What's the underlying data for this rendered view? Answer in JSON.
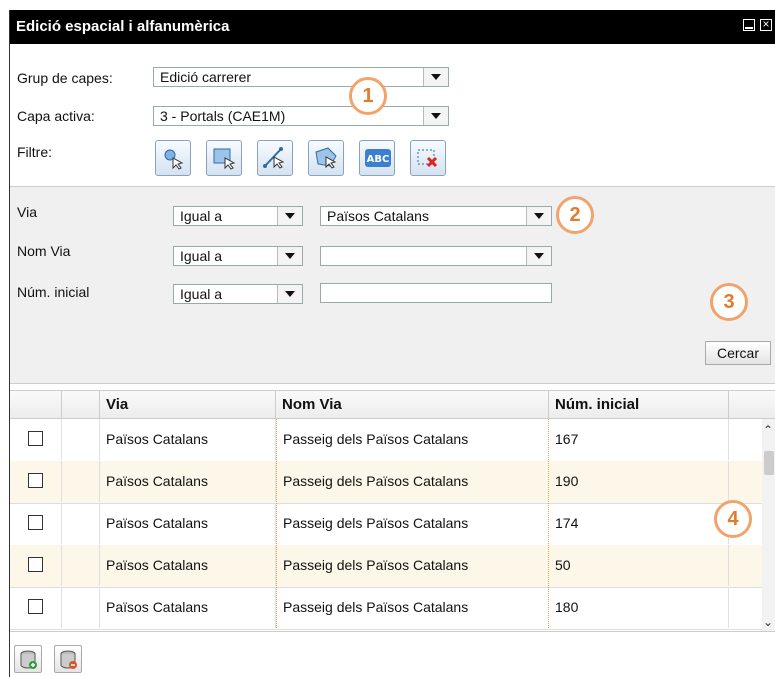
{
  "window": {
    "title": "Edició espacial i alfanumèrica"
  },
  "layer_group": {
    "label": "Grup de capes:",
    "value": "Edició carrerer"
  },
  "active_layer": {
    "label": "Capa activa:",
    "value": "3 - Portals (CAE1M)"
  },
  "filter": {
    "label": "Filtre:",
    "tools": [
      "select-point-icon",
      "select-rectangle-icon",
      "select-line-icon",
      "select-polygon-icon",
      "abc-text-icon",
      "clear-selection-icon"
    ],
    "tool_text_abc": "ABC"
  },
  "fields": [
    {
      "label": "Via",
      "operator": "Igual a",
      "value": "Països Catalans",
      "type": "select"
    },
    {
      "label": "Nom Via",
      "operator": "Igual a",
      "value": "",
      "type": "select"
    },
    {
      "label": "Núm. inicial",
      "operator": "Igual a",
      "value": "",
      "type": "text"
    }
  ],
  "search_button": "Cercar",
  "callouts": [
    "1",
    "2",
    "3",
    "4"
  ],
  "grid": {
    "columns": [
      "Via",
      "Nom Via",
      "Núm. inicial"
    ],
    "rows": [
      {
        "via": "Països Catalans",
        "nom_via": "Passeig dels Països Catalans",
        "num": "167"
      },
      {
        "via": "Països Catalans",
        "nom_via": "Passeig dels Països Catalans",
        "num": "190"
      },
      {
        "via": "Països Catalans",
        "nom_via": "Passeig dels Països Catalans",
        "num": "174"
      },
      {
        "via": "Països Catalans",
        "nom_via": "Passeig dels Països Catalans",
        "num": "50"
      },
      {
        "via": "Països Catalans",
        "nom_via": "Passeig dels Països Catalans",
        "num": "180"
      }
    ]
  },
  "bottom_buttons": [
    "add-record-icon",
    "delete-record-icon"
  ],
  "colors": {
    "accent_callout": "#e07b2f",
    "titlebar": "#000000",
    "row_alt": "#fdf7ea"
  }
}
